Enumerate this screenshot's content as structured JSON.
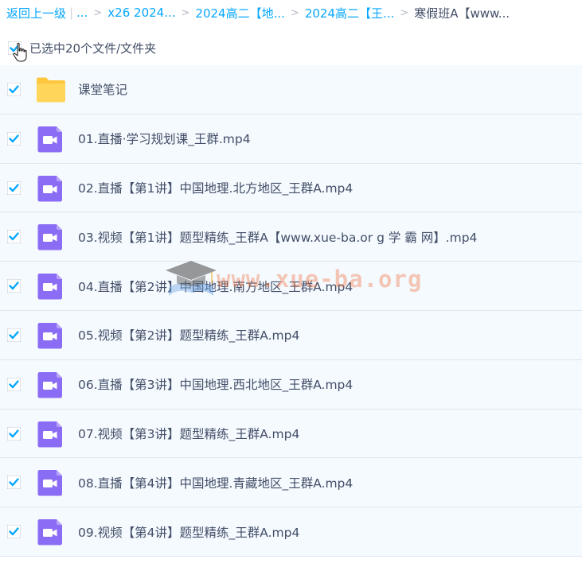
{
  "breadcrumb": {
    "back": "返回上一级",
    "pipe": "|",
    "ellipsis": "...",
    "items": [
      "x26 2024...",
      "2024高二【地...",
      "2024高二【王..."
    ],
    "current": "寒假班A【www..."
  },
  "selection": {
    "text": "已选中20个文件/文件夹"
  },
  "files": [
    {
      "name": "课堂笔记",
      "type": "folder",
      "checked": true
    },
    {
      "name": "01.直播·学习规划课_王群.mp4",
      "type": "video",
      "checked": true
    },
    {
      "name": "02.直播【第1讲】中国地理.北方地区_王群A.mp4",
      "type": "video",
      "checked": true
    },
    {
      "name": "03.视频【第1讲】题型精练_王群A【www.xue-ba.or g 学 霸 网】.mp4",
      "type": "video",
      "checked": true
    },
    {
      "name": "04.直播【第2讲】中国地理.南方地区_王群A.mp4",
      "type": "video",
      "checked": true
    },
    {
      "name": "05.视频【第2讲】题型精练_王群A.mp4",
      "type": "video",
      "checked": true
    },
    {
      "name": "06.直播【第3讲】中国地理.西北地区_王群A.mp4",
      "type": "video",
      "checked": true
    },
    {
      "name": "07.视频【第3讲】题型精练_王群A.mp4",
      "type": "video",
      "checked": true
    },
    {
      "name": "08.直播【第4讲】中国地理.青藏地区_王群A.mp4",
      "type": "video",
      "checked": true
    },
    {
      "name": "09.视频【第4讲】题型精练_王群A.mp4",
      "type": "video",
      "checked": true
    }
  ],
  "watermark": {
    "text": "www.xue-ba.org"
  },
  "colors": {
    "accent": "#06a7ff",
    "row_bg": "#f5faff",
    "video_icon": "#8b6cf4",
    "folder_icon": "#ffc73d"
  }
}
